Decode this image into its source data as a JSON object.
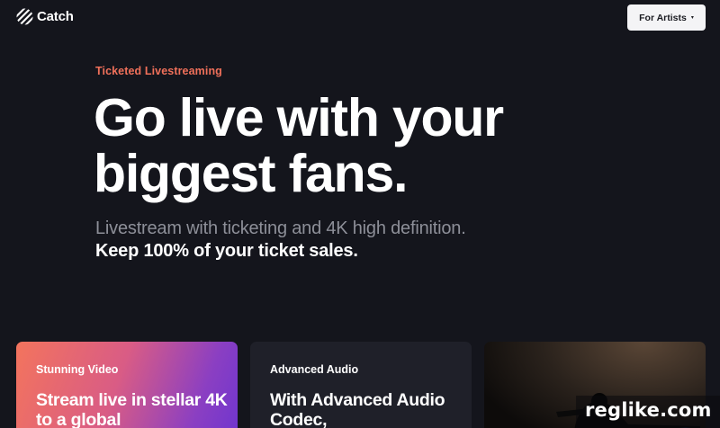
{
  "header": {
    "brand": "Catch",
    "artists_button_label": "For Artists",
    "artists_button_caret": "▾"
  },
  "hero": {
    "eyebrow": "Ticketed Livestreaming",
    "headline": "Go live with your biggest fans.",
    "subline_1": "Livestream with ticketing and 4K high definition.",
    "subline_2": "Keep 100% of your ticket sales."
  },
  "cards": [
    {
      "eyebrow": "Stunning Video",
      "title": "Stream live in stellar 4K to a global"
    },
    {
      "eyebrow": "Advanced Audio",
      "title": "With Advanced Audio Codec,"
    },
    {
      "eyebrow": "",
      "title": ""
    }
  ],
  "watermark": {
    "text": "reglike.com"
  },
  "colors": {
    "background": "#14151c",
    "accent_eyebrow": "#f0705a",
    "button_bg": "#f4f4f6",
    "muted_text": "#8d8f98"
  }
}
